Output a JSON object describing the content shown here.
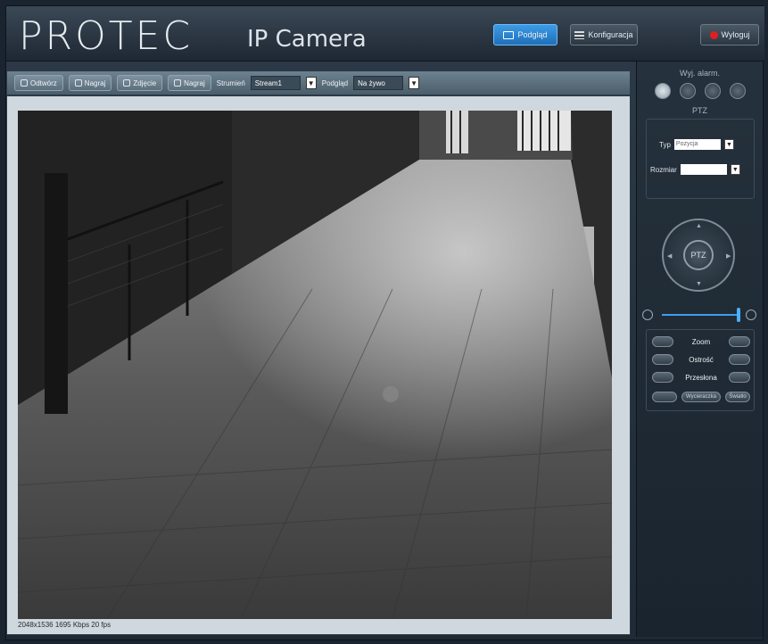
{
  "header": {
    "logo_text": "PROTEC",
    "logo_subtitle": "IP Camera",
    "live_label": "Podgląd",
    "config_label": "Konfiguracja",
    "logout_label": "Wyloguj"
  },
  "toolbar": {
    "btn_snapshot": "Odtwórz",
    "btn_record": "Nagraj",
    "btn_stop": "Zdjęcie",
    "btn_settings": "Nagraj",
    "stream_label": "Strumień",
    "stream_value": "Stream1",
    "preview_label": "Podgląd",
    "preview_value": "Na żywo"
  },
  "video": {
    "status_text": "2048x1536  1695 Kbps 20 fps"
  },
  "panel": {
    "alarm_title": "Wyj. alarm.",
    "ptz_title": "PTZ",
    "type_label": "Typ",
    "type_value": "Pozycja",
    "speed_label": "Rozmiar",
    "speed_value": "",
    "dpad_center": "PTZ",
    "zoom_label": "Zoom",
    "focus_label": "Ostrość",
    "iris_label": "Przesłona",
    "btn_a": "Wycieraczka",
    "btn_b": "Światło"
  },
  "colors": {
    "accent_blue": "#1f6fb8",
    "alarm_red": "#e02020"
  }
}
